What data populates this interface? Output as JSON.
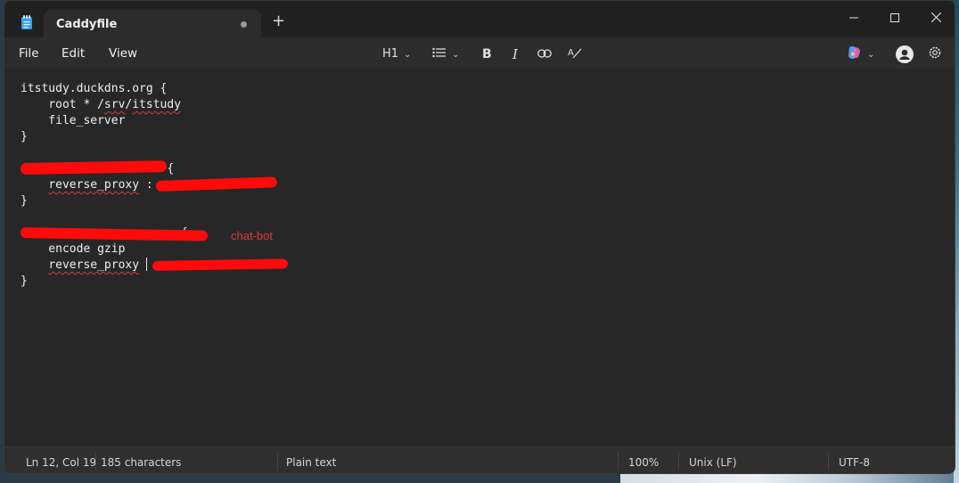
{
  "window": {
    "tab_title": "Caddyfile",
    "controls": {
      "minimize": "—",
      "maximize": "☐",
      "close": "✕"
    }
  },
  "menu": {
    "file": "File",
    "edit": "Edit",
    "view": "View"
  },
  "toolbar": {
    "heading": "H1",
    "icons": [
      "list-icon",
      "bold-icon",
      "italic-icon",
      "link-icon",
      "clear-format-icon",
      "copilot-icon",
      "profile-icon",
      "settings-icon"
    ]
  },
  "editor": {
    "lines": [
      "itstudy.duckdns.org {",
      "    root * /srv/itstudy",
      "    file_server",
      "}",
      "",
      "                     {",
      "    reverse_proxy :",
      "}",
      "",
      "                       {",
      "    encode gzip",
      "    reverse_proxy "
    ],
    "closing": "}",
    "annotation": "chat-bot",
    "redaction_color": "#ff0a0a"
  },
  "status": {
    "position": "Ln 12, Col 19",
    "characters": "185 characters",
    "format": "Plain text",
    "zoom": "100%",
    "line_ending": "Unix (LF)",
    "encoding": "UTF-8"
  }
}
